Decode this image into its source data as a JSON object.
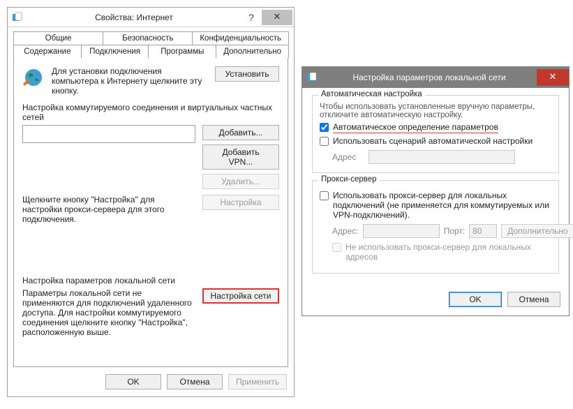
{
  "dlg1": {
    "title": "Свойства: Интернет",
    "help": "?",
    "close": "✕",
    "tabs_row1": [
      "Общие",
      "Безопасность",
      "Конфиденциальность"
    ],
    "tabs_row2": [
      "Содержание",
      "Подключения",
      "Программы",
      "Дополнительно"
    ],
    "active_tab": "Подключения",
    "setup_text": "Для установки подключения компьютера к Интернету щелкните эту кнопку.",
    "setup_btn": "Установить",
    "section_dialup": "Настройка коммутируемого соединения и виртуальных частных сетей",
    "btn_add": "Добавить...",
    "btn_add_vpn": "Добавить VPN...",
    "btn_delete": "Удалить...",
    "proxy_hint": "Щелкните кнопку \"Настройка\" для настройки прокси-сервера для этого подключения.",
    "btn_settings": "Настройка",
    "section_lan": "Настройка параметров локальной сети",
    "lan_hint": "Параметры локальной сети не применяются для подключений удаленного доступа. Для настройки коммутируемого соединения щелкните кнопку \"Настройка\", расположенную выше.",
    "btn_lan": "Настройка сети",
    "ok": "OK",
    "cancel": "Отмена",
    "apply": "Применить"
  },
  "dlg2": {
    "title": "Настройка параметров локальной сети",
    "close": "✕",
    "grp_auto": "Автоматическая настройка",
    "auto_hint": "Чтобы использовать установленные вручную параметры, отключите автоматическую настройку.",
    "chk_auto_detect": "Автоматическое определение параметров",
    "chk_auto_detect_checked": true,
    "chk_use_script": "Использовать сценарий автоматической настройки",
    "chk_use_script_checked": false,
    "addr_label": "Адрес",
    "addr_value": "",
    "grp_proxy": "Прокси-сервер",
    "chk_use_proxy": "Использовать прокси-сервер для локальных подключений (не применяется для коммутируемых или VPN-подключений).",
    "chk_use_proxy_checked": false,
    "proxy_addr_label": "Адрес:",
    "proxy_addr_value": "",
    "proxy_port_label": "Порт:",
    "proxy_port_value": "80",
    "btn_advanced": "Дополнительно",
    "chk_bypass_local": "Не использовать прокси-сервер для локальных адресов",
    "chk_bypass_local_checked": false,
    "ok": "OK",
    "cancel": "Отмена"
  }
}
